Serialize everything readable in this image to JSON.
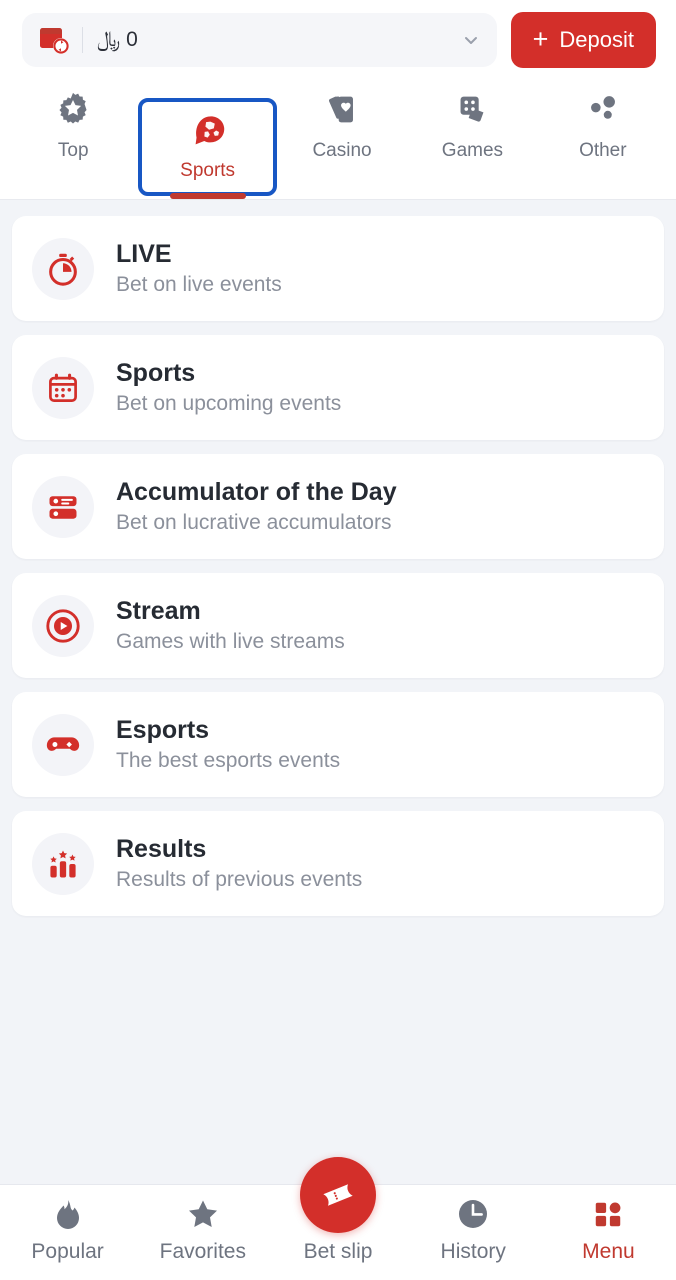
{
  "colors": {
    "accent_red": "#d32f2a",
    "accent_red_dark": "#c0392f",
    "focus_blue": "#1857c4",
    "page_bg": "#f2f4f8",
    "card_bg": "#ffffff",
    "muted_text": "#8b909b",
    "title_text": "#262b33"
  },
  "topbar": {
    "wallet_icon": "wallet-refresh-icon",
    "balance_value": "0 ﷼",
    "dropdown_icon": "chevron-down-icon",
    "deposit": {
      "plus": "+",
      "label": "Deposit"
    }
  },
  "tabs": [
    {
      "label": "Top",
      "icon": "gear-star-icon",
      "active": false,
      "focused": false
    },
    {
      "label": "Sports",
      "icon": "football-chat-icon",
      "active": true,
      "focused": true
    },
    {
      "label": "Casino",
      "icon": "playing-cards-icon",
      "active": false,
      "focused": false
    },
    {
      "label": "Games",
      "icon": "dice-icon",
      "active": false,
      "focused": false
    },
    {
      "label": "Other",
      "icon": "three-dots-icon",
      "active": false,
      "focused": false
    }
  ],
  "menu_items": [
    {
      "title": "LIVE",
      "subtitle": "Bet on live events",
      "icon": "stopwatch-icon"
    },
    {
      "title": "Sports",
      "subtitle": "Bet on upcoming events",
      "icon": "calendar-icon"
    },
    {
      "title": "Accumulator of the Day",
      "subtitle": "Bet on lucrative accumulators",
      "icon": "list-rows-icon"
    },
    {
      "title": "Stream",
      "subtitle": "Games with live streams",
      "icon": "play-circle-icon"
    },
    {
      "title": "Esports",
      "subtitle": "The best esports events",
      "icon": "gamepad-icon"
    },
    {
      "title": "Results",
      "subtitle": "Results of previous events",
      "icon": "podium-stars-icon"
    }
  ],
  "bottom_nav": [
    {
      "label": "Popular",
      "icon": "flame-icon",
      "active": false,
      "raised": false
    },
    {
      "label": "Favorites",
      "icon": "star-icon",
      "active": false,
      "raised": false
    },
    {
      "label": "Bet slip",
      "icon": "ticket-icon",
      "active": false,
      "raised": true
    },
    {
      "label": "History",
      "icon": "clock-icon",
      "active": false,
      "raised": false
    },
    {
      "label": "Menu",
      "icon": "grid-icon",
      "active": true,
      "raised": false
    }
  ]
}
